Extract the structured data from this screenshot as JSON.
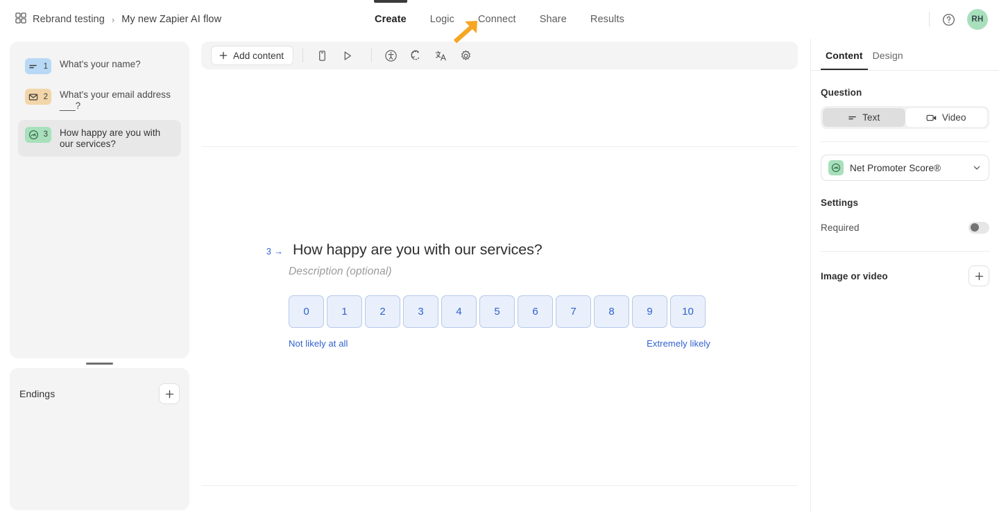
{
  "topbar": {
    "workspace_icon": "grid-icon",
    "breadcrumb_root": "Rebrand testing",
    "breadcrumb_separator": "›",
    "breadcrumb_current": "My new Zapier AI flow",
    "tabs": [
      {
        "label": "Create",
        "active": true
      },
      {
        "label": "Logic",
        "active": false
      },
      {
        "label": "Connect",
        "active": false
      },
      {
        "label": "Share",
        "active": false
      },
      {
        "label": "Results",
        "active": false
      }
    ],
    "help_icon": "question-circle-icon",
    "avatar_initials": "RH",
    "avatar_color": "#a8e0bc",
    "active_tab_indicator_color": "#3b3b3b"
  },
  "annotation": {
    "type": "arrow",
    "direction": "up-right",
    "color": "#f5a623",
    "points_to": "Connect"
  },
  "sidebar": {
    "questions": [
      {
        "number": "1",
        "label": "What's your name?",
        "icon": "short-text-icon",
        "badge_color": "#b8d9f5",
        "selected": false
      },
      {
        "number": "2",
        "label": "What's your email address ___?",
        "icon": "email-icon",
        "badge_color": "#f2d5a8",
        "selected": false
      },
      {
        "number": "3",
        "label": "How happy are you with our services?",
        "icon": "nps-gauge-icon",
        "badge_color": "#a8e0bc",
        "selected": true
      }
    ],
    "drag_handle": "resize-handle",
    "endings": {
      "title": "Endings",
      "add_icon": "plus-icon"
    }
  },
  "editor_toolbar": {
    "add_content_label": "Add content",
    "add_content_icon": "plus-icon",
    "buttons": [
      {
        "name": "mobile-preview-icon",
        "title": "Mobile preview"
      },
      {
        "name": "play-preview-icon",
        "title": "Preview"
      },
      {
        "name": "accessibility-icon",
        "title": "Accessibility"
      },
      {
        "name": "reset-icon",
        "title": "Reset"
      },
      {
        "name": "translate-icon",
        "title": "Translate"
      },
      {
        "name": "settings-gear-icon",
        "title": "Settings"
      }
    ]
  },
  "canvas": {
    "question_index": "3",
    "question_arrow": "→",
    "question_title": "How happy are you with our services?",
    "description_placeholder": "Description (optional)",
    "nps": {
      "options": [
        "0",
        "1",
        "2",
        "3",
        "4",
        "5",
        "6",
        "7",
        "8",
        "9",
        "10"
      ],
      "low_label": "Not likely at all",
      "high_label": "Extremely likely",
      "accent_color": "#2f5fd0",
      "fill_color": "#e9f0fb",
      "border_color": "#b5c8ea"
    }
  },
  "right_panel": {
    "tabs": [
      {
        "label": "Content",
        "active": true
      },
      {
        "label": "Design",
        "active": false
      }
    ],
    "question_section_title": "Question",
    "media_toggle": [
      {
        "label": "Text",
        "icon": "short-text-icon",
        "active": true
      },
      {
        "label": "Video",
        "icon": "video-camera-icon",
        "active": false
      }
    ],
    "question_type": {
      "name": "Net Promoter Score®",
      "icon": "nps-gauge-icon",
      "icon_bg": "#a8e0bc",
      "chevron": "chevron-down-icon"
    },
    "settings_title": "Settings",
    "required": {
      "label": "Required",
      "enabled": false
    },
    "image_or_video": {
      "label": "Image or video",
      "add_icon": "plus-icon"
    }
  }
}
